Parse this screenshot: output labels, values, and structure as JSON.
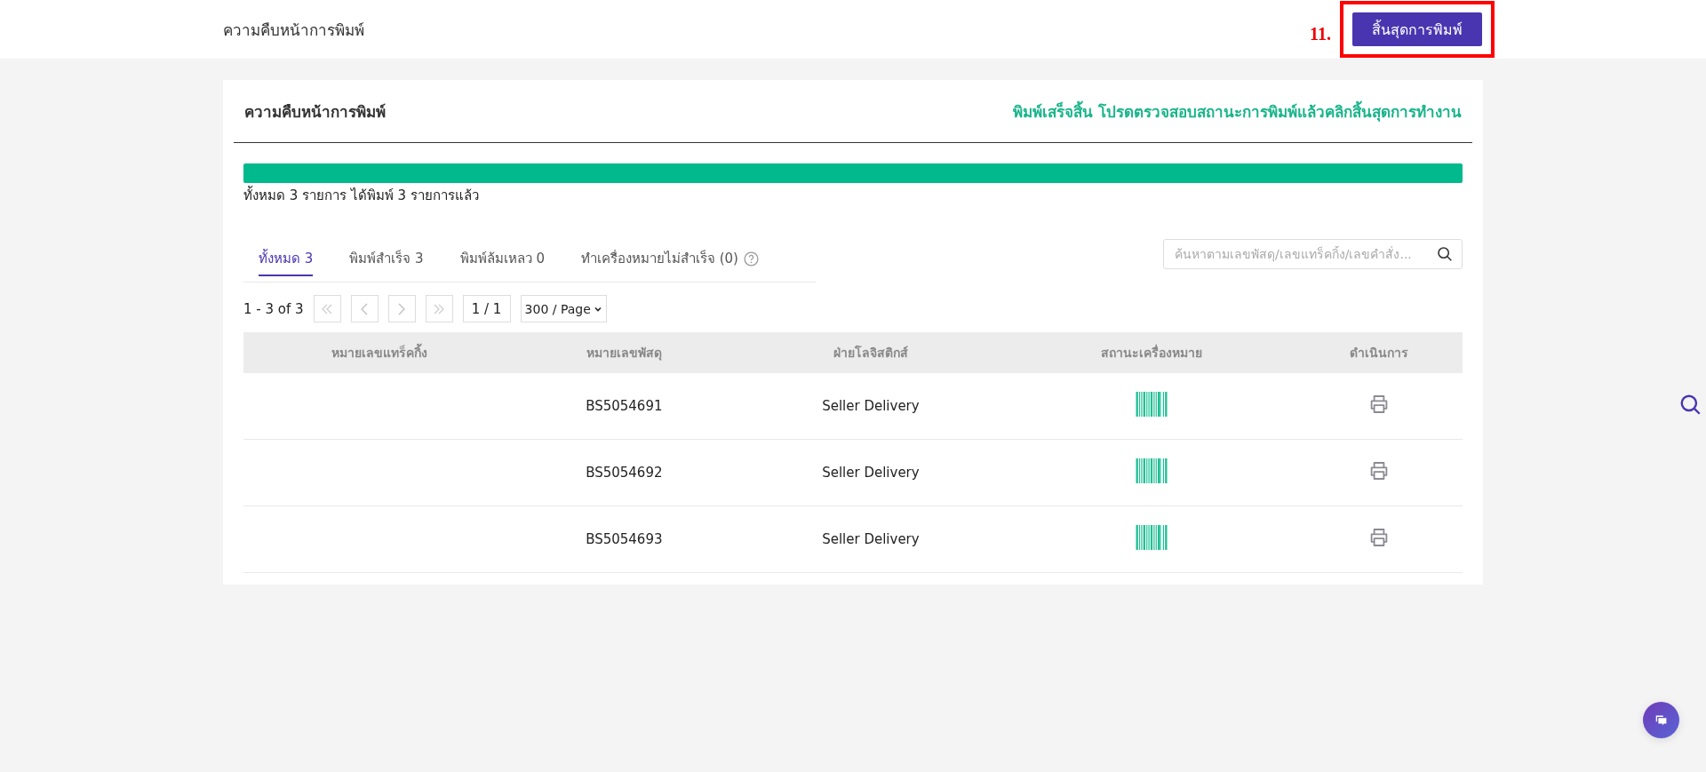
{
  "topbar": {
    "title": "ความคืบหน้าการพิมพ์",
    "step_label": "11.",
    "finish_button": "สิ้นสุดการพิมพ์",
    "highlighted": true
  },
  "card": {
    "title": "ความคืบหน้าการพิมพ์",
    "status_message": "พิมพ์เสร็จสิ้น โปรดตรวจสอบสถานะการพิมพ์แล้วคลิกสิ้นสุดการทำงาน"
  },
  "progress": {
    "level": 1,
    "summary": "ทั้งหมด 3 รายการ ได้พิมพ์ 3 รายการแล้ว"
  },
  "tabs": [
    {
      "label": "ทั้งหมด 3",
      "selected": true
    },
    {
      "label": "พิมพ์สำเร็จ 3",
      "selected": false
    },
    {
      "label": "พิมพ์ล้มเหลว 0",
      "selected": false
    },
    {
      "label": "ทำเครื่องหมายไม่สำเร็จ (0)",
      "selected": false,
      "help": true
    }
  ],
  "search": {
    "placeholder": "ค้นหาตามเลขพัสดุ/เลขแทร็คกิ้ง/เลขคำสั่ง..."
  },
  "pagination": {
    "range": "1 - 3 of 3",
    "page": "1 / 1",
    "page_size": "300 / Page"
  },
  "table": {
    "columns": [
      "หมายเลขแทร็คกิ้ง",
      "หมายเลขพัสดุ",
      "ฝ่ายโลจิสติกส์",
      "สถานะเครื่องหมาย",
      "ดำเนินการ"
    ],
    "rows": [
      {
        "tracking": "",
        "parcel": "BS5054691",
        "logistics": "Seller Delivery",
        "marked": true
      },
      {
        "tracking": "",
        "parcel": "BS5054692",
        "logistics": "Seller Delivery",
        "marked": true
      },
      {
        "tracking": "",
        "parcel": "BS5054693",
        "logistics": "Seller Delivery",
        "marked": true
      }
    ]
  }
}
